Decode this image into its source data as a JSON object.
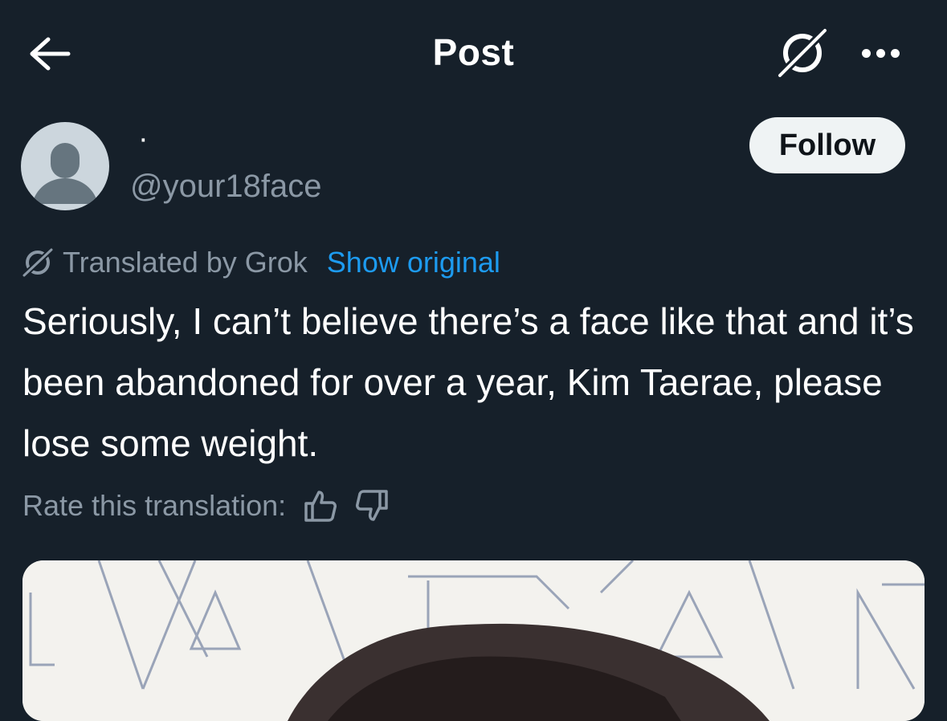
{
  "header": {
    "title": "Post",
    "back_icon": "arrow-left-icon",
    "grok_icon": "grok-icon",
    "more_icon": "more-horizontal-icon"
  },
  "author": {
    "display_name": "·",
    "handle": "@your18face",
    "follow_label": "Follow",
    "avatar_icon": "default-avatar-icon"
  },
  "translation": {
    "label": "Translated by Grok",
    "show_original": "Show original",
    "rate_label": "Rate this translation:",
    "thumbs_up_icon": "thumbs-up-icon",
    "thumbs_down_icon": "thumbs-down-icon"
  },
  "post": {
    "text": "Seriously, I can’t believe there’s a face like that and it’s been abandoned for over a year, Kim Taerae, please lose some weight."
  },
  "colors": {
    "background": "#16202a",
    "text_primary": "#ffffff",
    "text_secondary": "#8b98a5",
    "link": "#1d9bf0",
    "follow_bg": "#eff3f4"
  }
}
